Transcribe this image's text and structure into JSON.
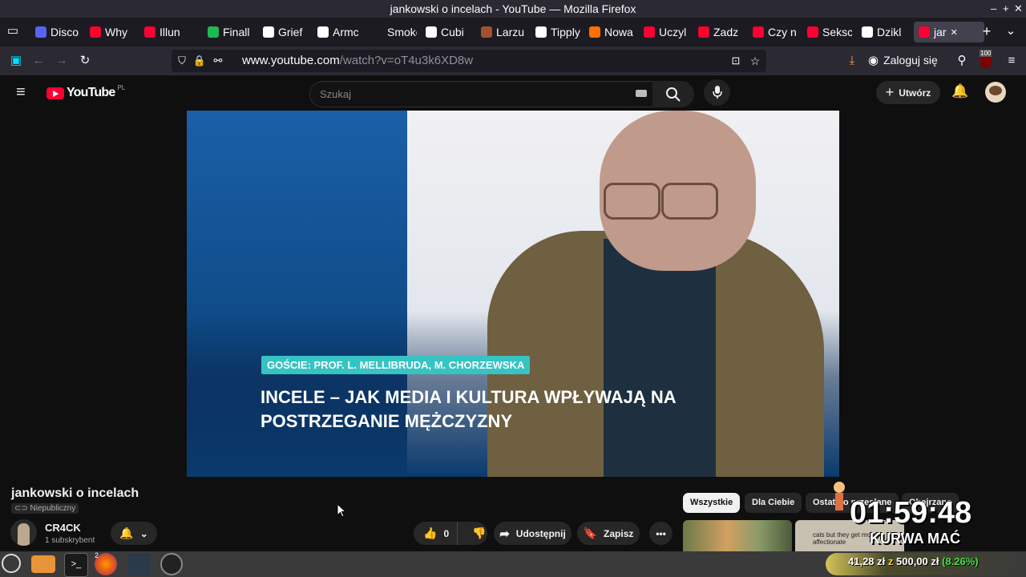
{
  "window": {
    "title": "jankowski o incelach - YouTube — Mozilla Firefox"
  },
  "tabs": [
    {
      "label": "Disco",
      "fav_color": "#5865f2"
    },
    {
      "label": "Why",
      "fav_color": "#ff0033"
    },
    {
      "label": "Illun",
      "fav_color": "#ff0033"
    },
    {
      "label": "Finall",
      "fav_color": "#1db954"
    },
    {
      "label": "Grief",
      "fav_color": "#ffffff"
    },
    {
      "label": "Armc",
      "fav_color": "#ffffff"
    },
    {
      "label": "Smoke I",
      "fav_color": "#1c1b22"
    },
    {
      "label": "Cubi",
      "fav_color": "#ffffff"
    },
    {
      "label": "Larzu",
      "fav_color": "#a0522d"
    },
    {
      "label": "Tipply",
      "fav_color": "#ffffff"
    },
    {
      "label": "Nowa",
      "fav_color": "#ff6f00"
    },
    {
      "label": "Uczyl",
      "fav_color": "#ff0033"
    },
    {
      "label": "Zadz",
      "fav_color": "#ff0033"
    },
    {
      "label": "Czy n",
      "fav_color": "#ff0033"
    },
    {
      "label": "Seksc",
      "fav_color": "#ff0033"
    },
    {
      "label": "Dzikl",
      "fav_color": "#ffffff"
    },
    {
      "label": "jar",
      "fav_color": "#ff0033"
    }
  ],
  "navbar": {
    "url_domain": "www.youtube.com",
    "url_path": "/watch?v=oT4u3k6XD8w",
    "login_label": "Zaloguj się",
    "badge": "100"
  },
  "youtube": {
    "logo_text": "YouTube",
    "country": "PL",
    "search_placeholder": "Szukaj",
    "create_label": "Utwórz"
  },
  "video": {
    "guests_banner": "GOŚCIE: PROF. L. MELLIBRUDA, M. CHORZEWSKA",
    "headline_1": "INCELE – JAK MEDIA I KULTURA WPŁYWAJĄ NA",
    "headline_2": "POSTRZEGANIE MĘŻCZYZNY"
  },
  "details": {
    "title": "jankowski o incelach",
    "visibility": "Niepubliczny",
    "channel": "CR4CK",
    "subscribers": "1 subskrybent",
    "likes": "0",
    "share_label": "Udostępnij",
    "save_label": "Zapisz"
  },
  "chips": [
    "Wszystkie",
    "Dla Ciebie",
    "Ostatnio przesłane",
    "Obejrzane"
  ],
  "overlay": {
    "timer": "01:59:48",
    "text": "KURWA MAĆ",
    "thumb_caption": "cats but they get more affectionate",
    "donation_current": "41,28 zł",
    "donation_sep": "z",
    "donation_goal": "500,00 zł",
    "donation_pct": "(8.26%)"
  },
  "taskbar": {
    "firefox_count": "2"
  }
}
